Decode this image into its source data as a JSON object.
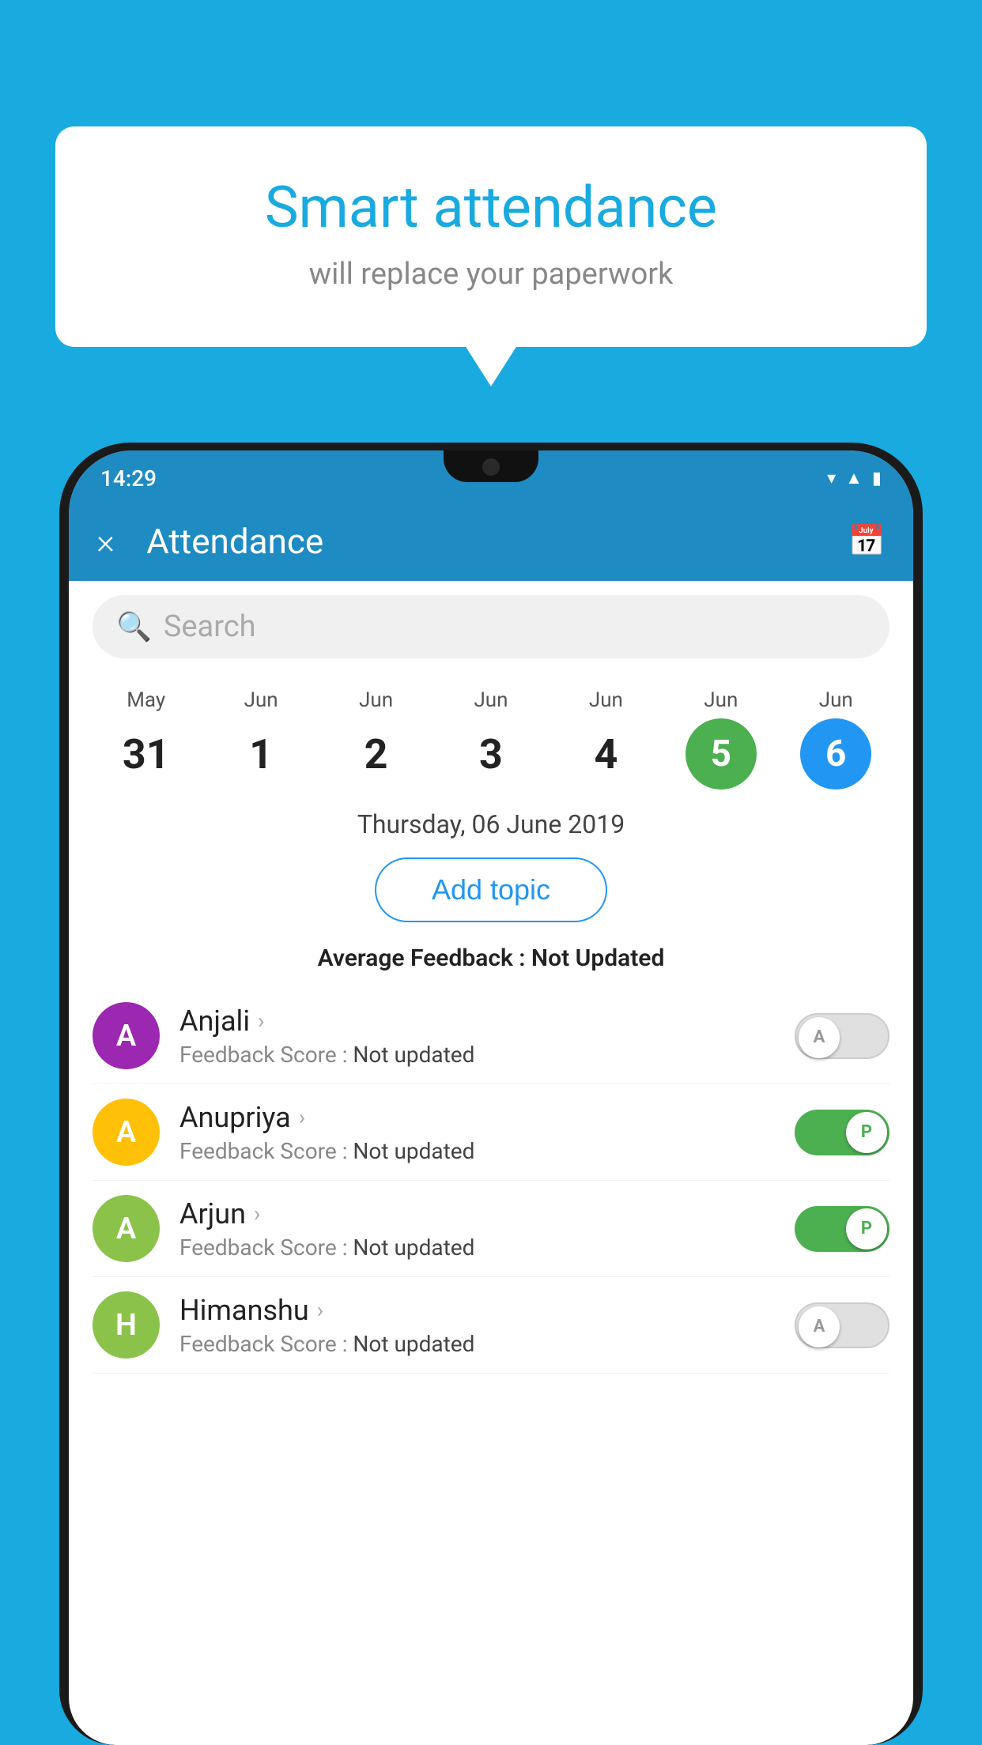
{
  "bubble": {
    "title": "Smart attendance",
    "subtitle": "will replace your paperwork"
  },
  "phone": {
    "status_bar": {
      "time": "14:29"
    },
    "header": {
      "title": "Attendance",
      "close_label": "×",
      "calendar_icon": "📅"
    },
    "search": {
      "placeholder": "Search"
    },
    "dates": [
      {
        "month": "May",
        "day": "31",
        "style": "normal"
      },
      {
        "month": "Jun",
        "day": "1",
        "style": "normal"
      },
      {
        "month": "Jun",
        "day": "2",
        "style": "normal"
      },
      {
        "month": "Jun",
        "day": "3",
        "style": "normal"
      },
      {
        "month": "Jun",
        "day": "4",
        "style": "normal"
      },
      {
        "month": "Jun",
        "day": "5",
        "style": "green"
      },
      {
        "month": "Jun",
        "day": "6",
        "style": "blue"
      }
    ],
    "selected_date": "Thursday, 06 June 2019",
    "add_topic_label": "Add topic",
    "avg_feedback_label": "Average Feedback : ",
    "avg_feedback_value": "Not Updated",
    "students": [
      {
        "name": "Anjali",
        "avatar_letter": "A",
        "avatar_color": "#9C27B0",
        "feedback_label": "Feedback Score : ",
        "feedback_value": "Not updated",
        "toggle": "off",
        "toggle_letter": "A"
      },
      {
        "name": "Anupriya",
        "avatar_letter": "A",
        "avatar_color": "#FFC107",
        "feedback_label": "Feedback Score : ",
        "feedback_value": "Not updated",
        "toggle": "on",
        "toggle_letter": "P"
      },
      {
        "name": "Arjun",
        "avatar_letter": "A",
        "avatar_color": "#8BC34A",
        "feedback_label": "Feedback Score : ",
        "feedback_value": "Not updated",
        "toggle": "on",
        "toggle_letter": "P"
      },
      {
        "name": "Himanshu",
        "avatar_letter": "H",
        "avatar_color": "#8BC34A",
        "feedback_label": "Feedback Score : ",
        "feedback_value": "Not updated",
        "toggle": "off",
        "toggle_letter": "A"
      }
    ]
  },
  "colors": {
    "bg": "#19AADF",
    "header": "#1E8BC3",
    "green": "#4CAF50",
    "blue": "#2196F3"
  }
}
